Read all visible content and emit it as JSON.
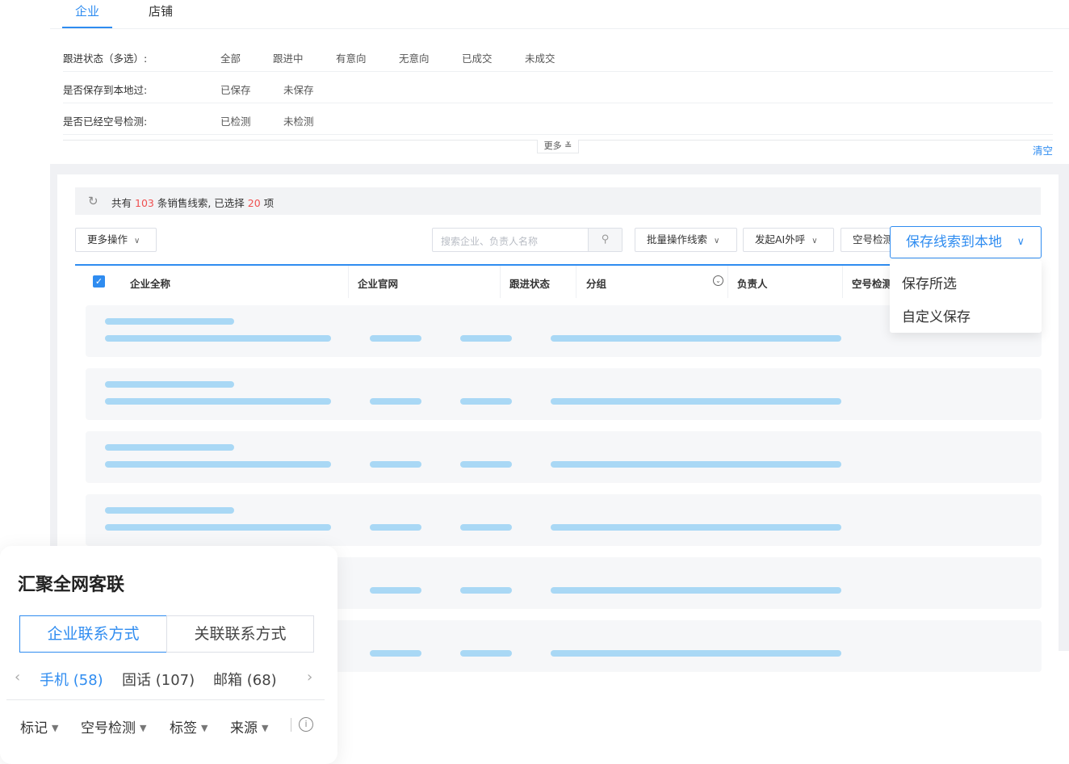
{
  "tabs": {
    "company": "企业",
    "store": "店铺"
  },
  "filters": {
    "follow_status": {
      "label": "跟进状态（多选）:",
      "options": [
        "全部",
        "跟进中",
        "有意向",
        "无意向",
        "已成交",
        "未成交"
      ]
    },
    "saved_local": {
      "label": "是否保存到本地过:",
      "options": [
        "已保存",
        "未保存"
      ]
    },
    "empty_check": {
      "label": "是否已经空号检测:",
      "options": [
        "已检测",
        "未检测"
      ]
    },
    "more_label": "更多 ≚",
    "clear_label": "清空"
  },
  "summary": {
    "prefix": "共有",
    "total": "103",
    "middle": "条销售线索, 已选择",
    "selected": "20",
    "suffix": "项",
    "refresh_icon": "refresh-icon"
  },
  "toolbar": {
    "more_ops": "更多操作",
    "search_placeholder": "搜索企业、负责人名称",
    "batch_ops": "批量操作线索",
    "ai_call": "发起AI外呼",
    "empty_check": "空号检测",
    "save_local": "保存线索到本地"
  },
  "dropdown": {
    "items": [
      "保存所选",
      "自定义保存"
    ]
  },
  "table": {
    "headers": [
      "企业全称",
      "企业官网",
      "跟进状态",
      "分组",
      "负责人",
      "空号检测"
    ]
  },
  "card": {
    "title": "汇聚全网客联",
    "segments": [
      "企业联系方式",
      "关联联系方式"
    ],
    "contact_tabs": [
      "手机 (58)",
      "固话 (107)",
      "邮箱 (68)"
    ],
    "filters": [
      "标记",
      "空号检测",
      "标签",
      "来源"
    ]
  },
  "colors": {
    "accent": "#2f8cf0",
    "highlight": "#f05050",
    "skeleton": "#a9d8f5"
  }
}
